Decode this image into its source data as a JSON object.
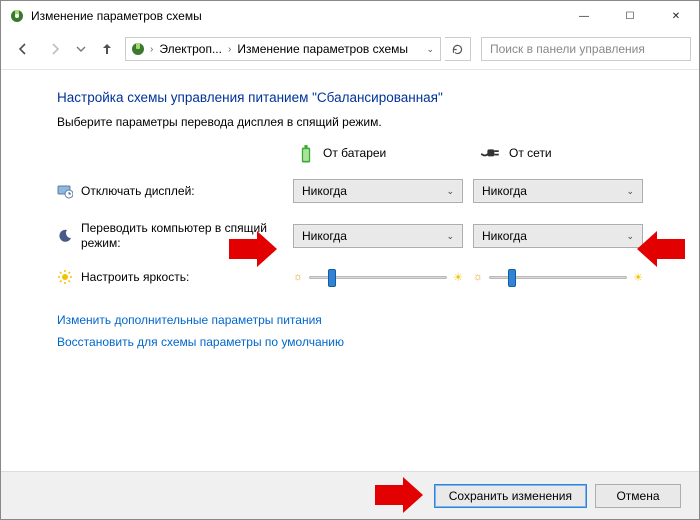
{
  "window": {
    "title": "Изменение параметров схемы"
  },
  "nav": {
    "breadcrumb": {
      "root_short": "Электроп...",
      "current": "Изменение параметров схемы"
    },
    "search_placeholder": "Поиск в панели управления"
  },
  "page": {
    "heading": "Настройка схемы управления питанием \"Сбалансированная\"",
    "subtext": "Выберите параметры перевода дисплея в спящий режим.",
    "col_battery": "От батареи",
    "col_ac": "От сети",
    "row_display_off": "Отключать дисплей:",
    "row_sleep": "Переводить компьютер в спящий режим:",
    "row_brightness": "Настроить яркость:",
    "combo_value": "Никогда",
    "display_off": {
      "battery": "Никогда",
      "ac": "Никогда"
    },
    "sleep": {
      "battery": "Никогда",
      "ac": "Никогда"
    },
    "brightness_pct": {
      "battery": 14,
      "ac": 14
    },
    "link_advanced": "Изменить дополнительные параметры питания",
    "link_restore": "Восстановить для схемы параметры по умолчанию"
  },
  "footer": {
    "save": "Сохранить изменения",
    "cancel": "Отмена"
  },
  "icons": {
    "app": "power-options-icon",
    "battery": "battery-icon",
    "ac": "ac-plug-icon",
    "display": "monitor-clock-icon",
    "sleep": "moon-icon",
    "brightness": "sun-icon"
  },
  "colors": {
    "link": "#0066cc",
    "heading": "#003399",
    "accent": "#2e84d6",
    "callout": "#e30000"
  }
}
